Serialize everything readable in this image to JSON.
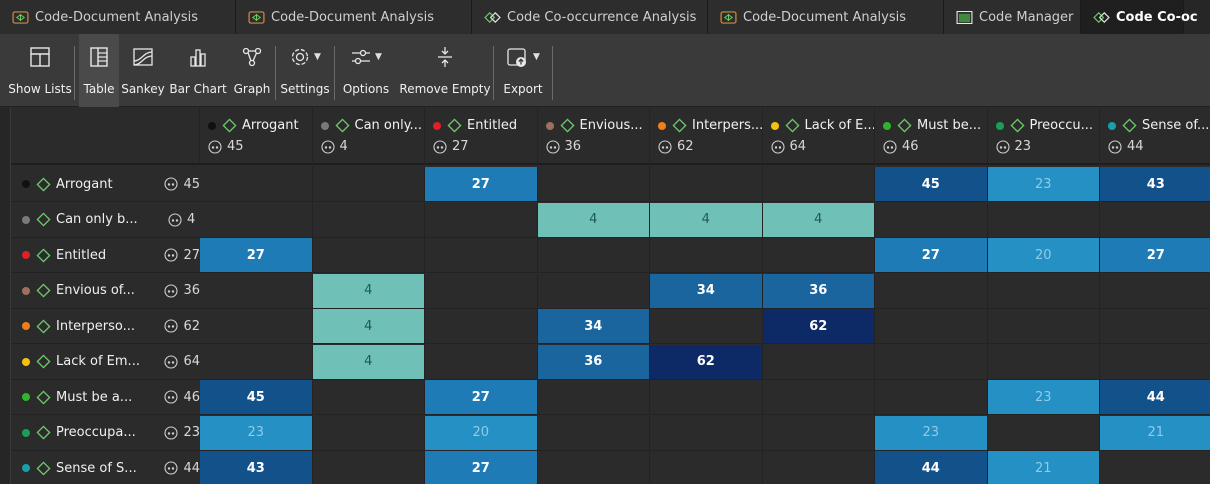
{
  "tabs": [
    {
      "label": "Code-Document Analysis",
      "icon": "doc-analysis-icon",
      "active": false
    },
    {
      "label": "Code-Document Analysis",
      "icon": "doc-analysis-icon",
      "active": false
    },
    {
      "label": "Code Co-occurrence Analysis",
      "icon": "cooccurrence-icon",
      "active": false
    },
    {
      "label": "Code-Document Analysis",
      "icon": "doc-analysis-icon",
      "active": false
    },
    {
      "label": "Code Manager",
      "icon": "code-manager-icon",
      "active": false
    },
    {
      "label": "Code Co-oc",
      "icon": "cooccurrence-icon",
      "active": true
    }
  ],
  "ribbon": {
    "show_lists": "Show Lists",
    "table": "Table",
    "sankey": "Sankey",
    "bar_chart": "Bar Chart",
    "graph": "Graph",
    "settings": "Settings",
    "options": "Options",
    "remove_empty": "Remove Empty",
    "export": "Export"
  },
  "codes": [
    {
      "name": "Arrogant",
      "row_name": "Arrogant",
      "count": "45",
      "color": "#111111"
    },
    {
      "name": "Can only...",
      "row_name": "Can only b...",
      "count": "4",
      "color": "#7a7a7a"
    },
    {
      "name": "Entitled",
      "row_name": "Entitled",
      "count": "27",
      "color": "#e0202a"
    },
    {
      "name": "Envious...",
      "row_name": "Envious of...",
      "count": "36",
      "color": "#a0705e"
    },
    {
      "name": "Interpers...",
      "row_name": "Interperso...",
      "count": "62",
      "color": "#f07f1a"
    },
    {
      "name": "Lack of E...",
      "row_name": "Lack of Em...",
      "count": "64",
      "color": "#f4c20d"
    },
    {
      "name": "Must be...",
      "row_name": "Must be a...",
      "count": "46",
      "color": "#2db52d"
    },
    {
      "name": "Preoccu...",
      "row_name": "Preoccupa...",
      "count": "23",
      "color": "#1a9e5a"
    },
    {
      "name": "Sense of...",
      "row_name": "Sense of S...",
      "count": "44",
      "color": "#17a0a8"
    }
  ],
  "matrix": [
    [
      "",
      "",
      "27",
      "",
      "",
      "",
      "45",
      "23",
      "43"
    ],
    [
      "",
      "",
      "",
      "4",
      "4",
      "4",
      "",
      "",
      ""
    ],
    [
      "27",
      "",
      "",
      "",
      "",
      "",
      "27",
      "20",
      "27"
    ],
    [
      "",
      "4",
      "",
      "",
      "34",
      "36",
      "",
      "",
      ""
    ],
    [
      "",
      "4",
      "",
      "34",
      "",
      "62",
      "",
      "",
      ""
    ],
    [
      "",
      "4",
      "",
      "36",
      "62",
      "",
      "",
      "",
      ""
    ],
    [
      "45",
      "",
      "27",
      "",
      "",
      "",
      "",
      "23",
      "44"
    ],
    [
      "23",
      "",
      "20",
      "",
      "",
      "",
      "23",
      "",
      "21"
    ],
    [
      "43",
      "",
      "27",
      "",
      "",
      "",
      "44",
      "21",
      ""
    ]
  ],
  "colors": {
    "c62": "#0d2a66",
    "c45": "#12518a",
    "c34": "#1a659d",
    "c27": "#1f7bb6",
    "c20": "#2490c4",
    "c4": "#6fc1b7"
  }
}
